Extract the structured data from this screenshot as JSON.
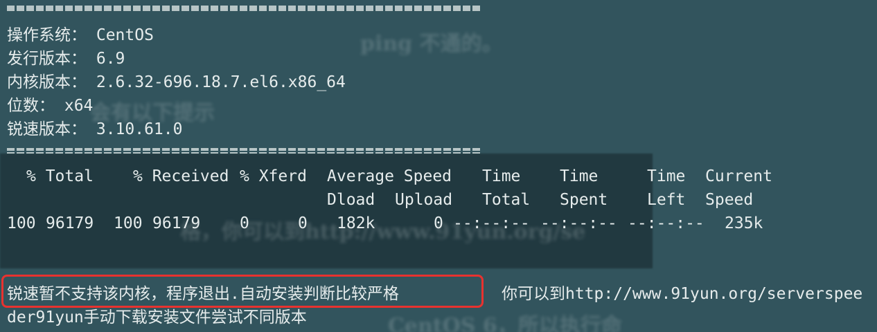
{
  "terminal": {
    "system_info": [
      "操作系统： CentOS",
      "发行版本： 6.9",
      "内核版本： 2.6.32-696.18.7.el6.x86_64",
      "位数： x64",
      "锐速版本： 3.10.61.0"
    ],
    "curl_header_row1": [
      "% Total",
      "% Received",
      "% Xferd",
      "Average Speed",
      "Time",
      "Time",
      "Time",
      "Current"
    ],
    "curl_header_row2": [
      "Dload",
      "Upload",
      "Total",
      "Spent",
      "Left",
      "Speed"
    ],
    "curl_values": [
      "100",
      "96179",
      "100",
      "96179",
      "0",
      "0",
      "182k",
      "0",
      "--:--:--",
      "--:--:--",
      "--:--:--",
      "235k"
    ],
    "error_message": "锐速暂不支持该内核，程序退出.自动安装判断比较严格",
    "error_hint_line1": "你可以到http://www.91yun.org/serverspee",
    "error_hint_line2": "der91yun手动下载安装文件尝试不同版本"
  },
  "colors": {
    "background": "#32545d",
    "text": "#e6ecec",
    "highlight_border": "#e8322f"
  }
}
